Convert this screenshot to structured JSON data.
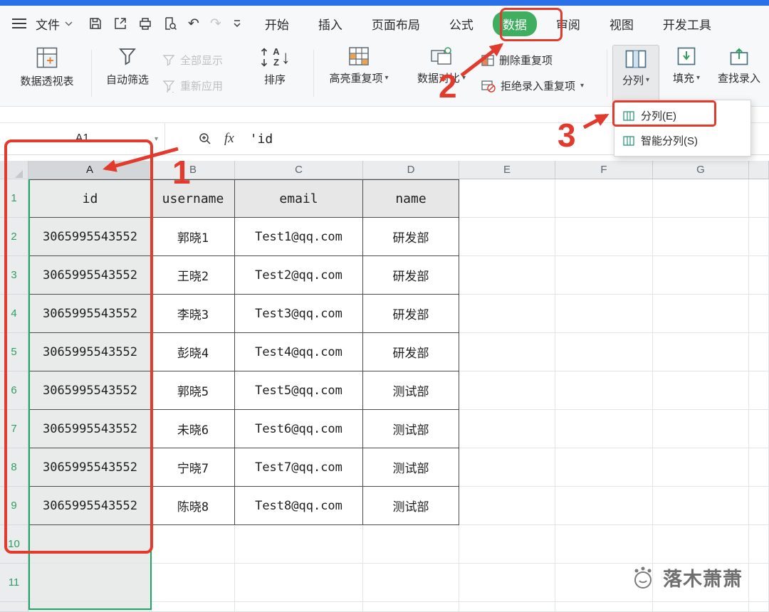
{
  "window": {
    "accent_blue": "#2a70e8"
  },
  "menubar": {
    "file_label": "文件",
    "tabs": [
      {
        "id": "home",
        "label": "开始"
      },
      {
        "id": "insert",
        "label": "插入"
      },
      {
        "id": "page-layout",
        "label": "页面布局"
      },
      {
        "id": "formulas",
        "label": "公式"
      },
      {
        "id": "data",
        "label": "数据",
        "active": true
      },
      {
        "id": "review",
        "label": "审阅"
      },
      {
        "id": "view",
        "label": "视图"
      },
      {
        "id": "developer",
        "label": "开发工具"
      }
    ]
  },
  "ribbon": {
    "pivot_table": "数据透视表",
    "auto_filter": "自动筛选",
    "show_all": "全部显示",
    "reapply": "重新应用",
    "sort": "排序",
    "sort_icon_a": "A",
    "sort_icon_z": "Z",
    "highlight_duplicates": "高亮重复项",
    "data_compare": "数据对比",
    "remove_duplicates": "删除重复项",
    "reject_duplicates": "拒绝录入重复项",
    "split_columns": "分列",
    "fill": "填充",
    "find_entry": "查找录入"
  },
  "split_menu": {
    "items": [
      {
        "label": "分列(E)"
      },
      {
        "label": "智能分列(S)"
      }
    ]
  },
  "formula_bar": {
    "cell_ref": "A1",
    "fx_label": "fx",
    "content": "'id"
  },
  "sheet": {
    "columns": [
      "A",
      "B",
      "C",
      "D",
      "E",
      "F",
      "G"
    ],
    "row_numbers": [
      "1",
      "2",
      "3",
      "4",
      "5",
      "6",
      "7",
      "8",
      "9",
      "10",
      "11"
    ],
    "header_row": [
      "id",
      "username",
      "email",
      "name"
    ],
    "rows": [
      [
        "3065995543552",
        "郭晓1",
        "Test1@qq.com",
        "研发部"
      ],
      [
        "3065995543552",
        "王晓2",
        "Test2@qq.com",
        "研发部"
      ],
      [
        "3065995543552",
        "李晓3",
        "Test3@qq.com",
        "研发部"
      ],
      [
        "3065995543552",
        "彭晓4",
        "Test4@qq.com",
        "研发部"
      ],
      [
        "3065995543552",
        "郭晓5",
        "Test5@qq.com",
        "测试部"
      ],
      [
        "3065995543552",
        "未晓6",
        "Test6@qq.com",
        "测试部"
      ],
      [
        "3065995543552",
        "宁晓7",
        "Test7@qq.com",
        "测试部"
      ],
      [
        "3065995543552",
        "陈晓8",
        "Test8@qq.com",
        "测试部"
      ]
    ]
  },
  "annotations": {
    "step1": "1",
    "step2": "2",
    "step3": "3",
    "color": "#e23a2d"
  },
  "selection": {
    "color": "#1fa565"
  },
  "active_tab_color": "#3fae5f",
  "watermark": {
    "text": "落木萧萧"
  }
}
